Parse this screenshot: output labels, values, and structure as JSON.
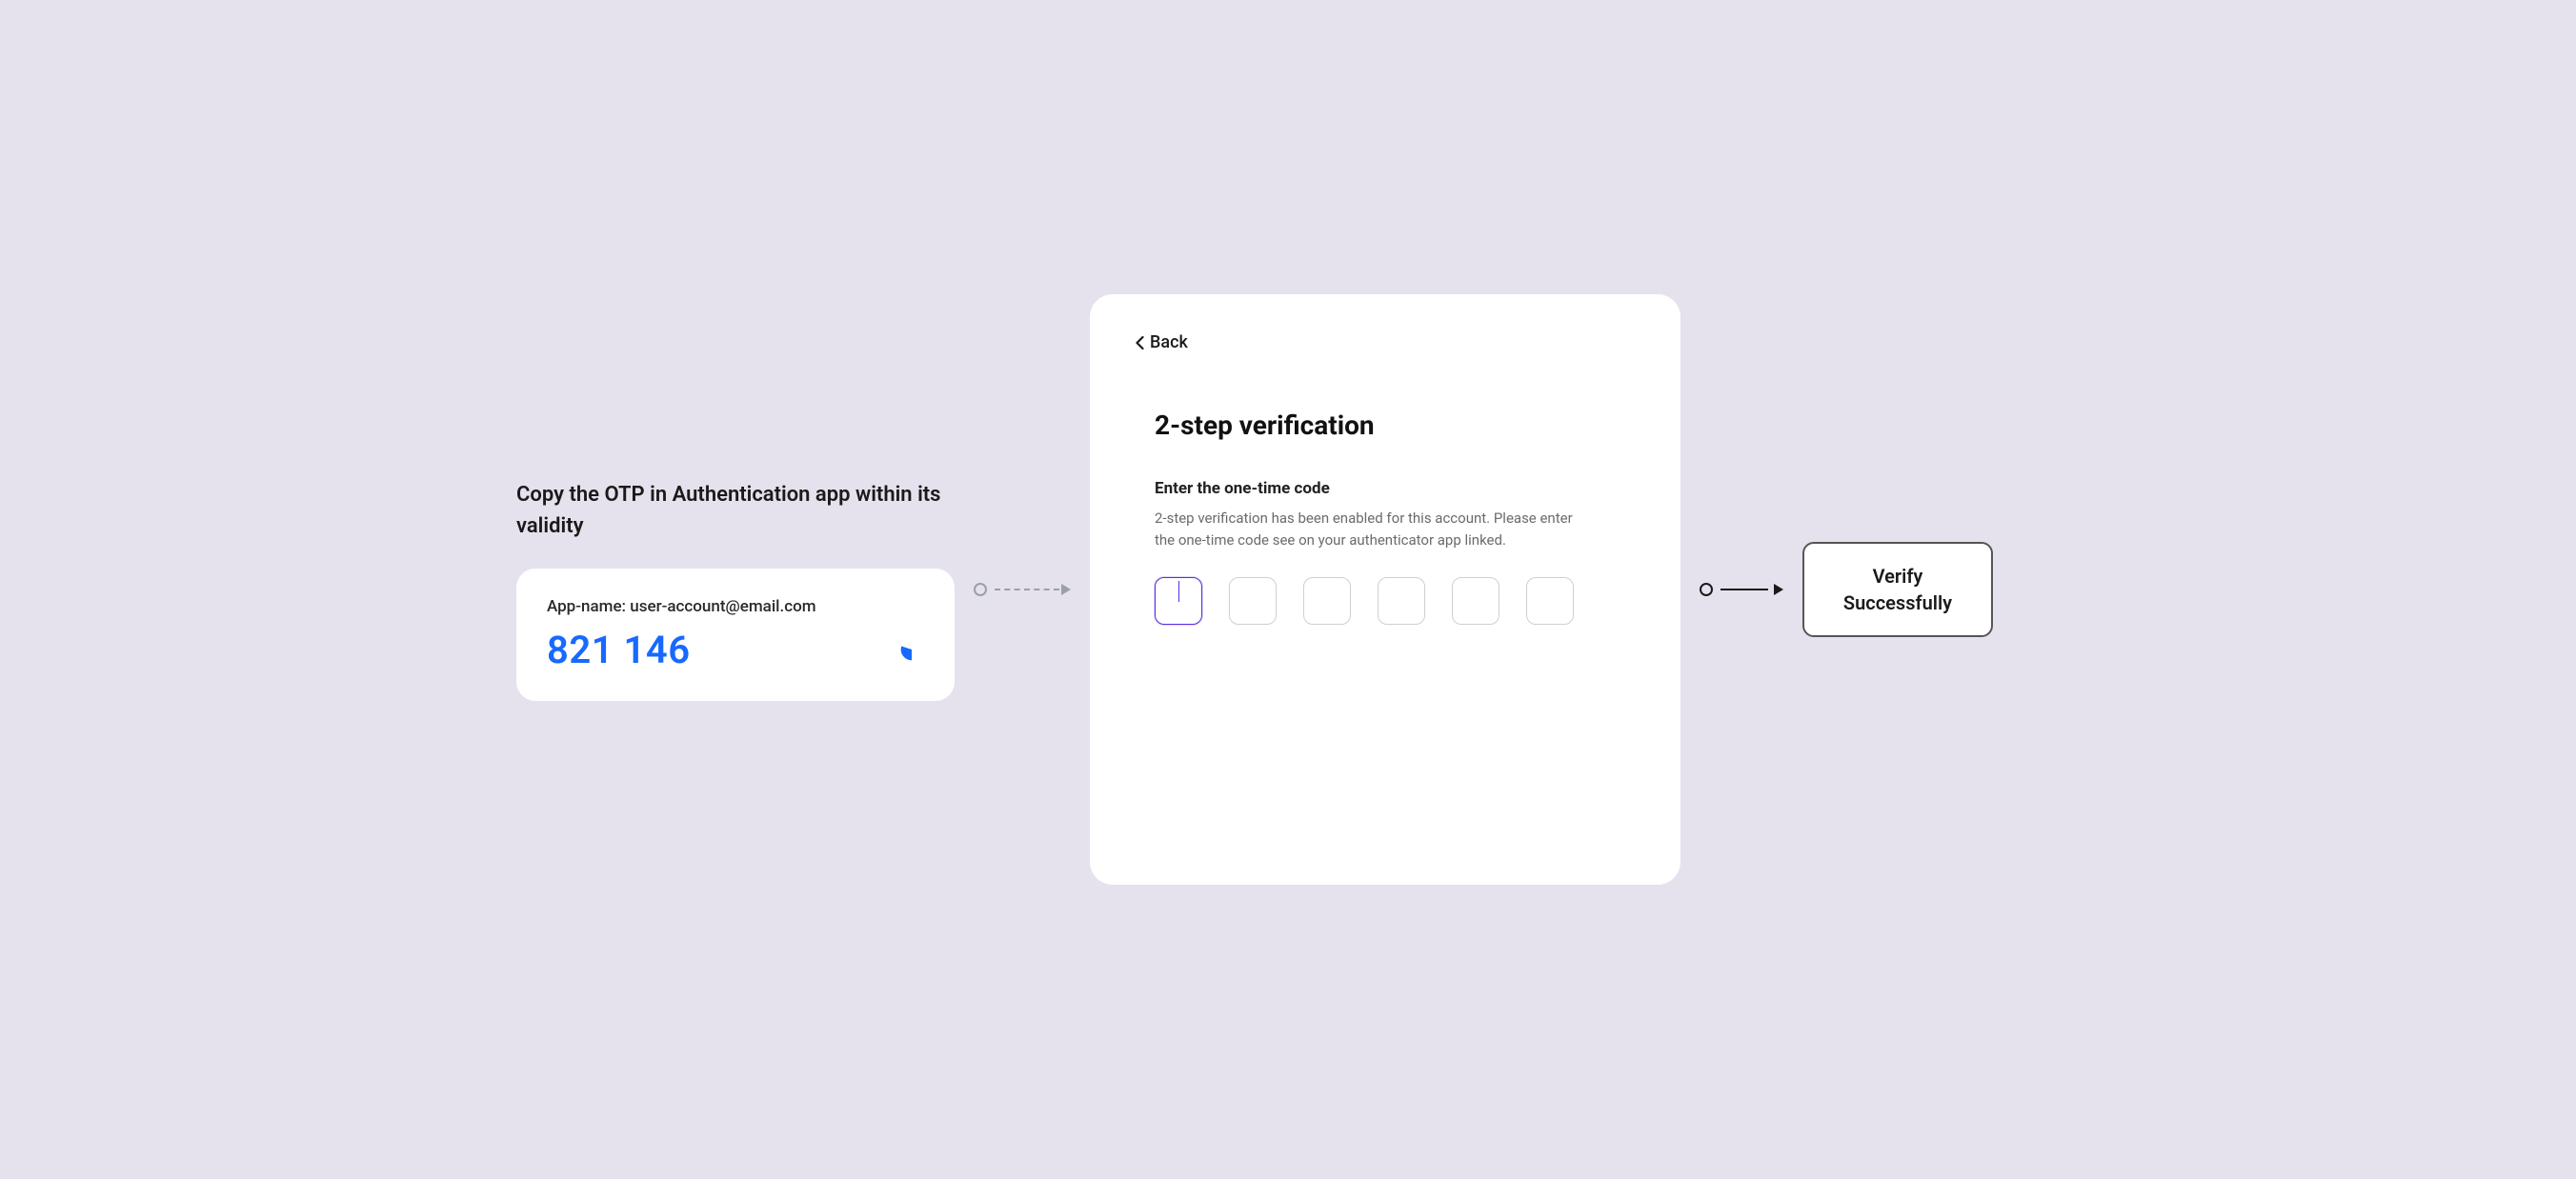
{
  "left": {
    "title": "Copy the OTP in Authentication app within its validity",
    "account": "App-name: user-account@email.com",
    "code": "821 146"
  },
  "verify": {
    "back_label": "Back",
    "title": "2-step verification",
    "subtitle": "Enter the one-time code",
    "description": "2-step verification has been enabled for this account. Please enter the one-time code see on your authenticator app linked."
  },
  "success": {
    "line1": "Verify",
    "line2": "Successfully"
  },
  "colors": {
    "bg": "#E5E2ED",
    "accent_blue": "#1769FF",
    "accent_purple": "#5A2FE0"
  }
}
